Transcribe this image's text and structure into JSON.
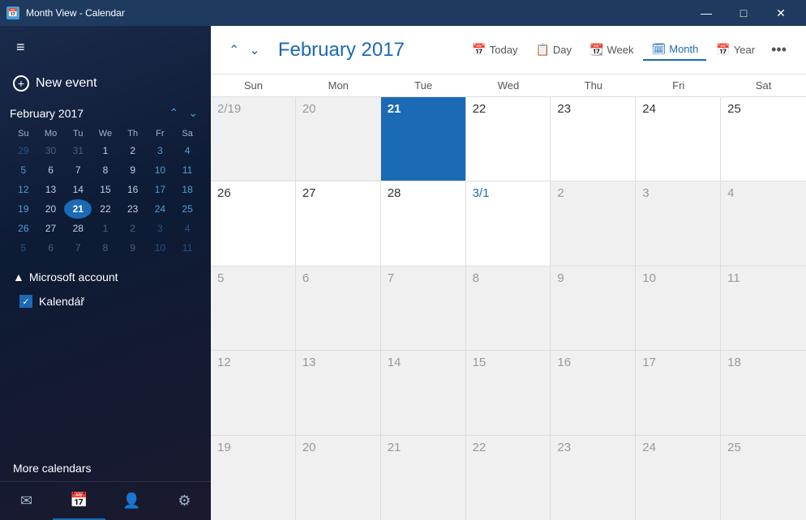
{
  "titlebar": {
    "title": "Month View - Calendar",
    "minimize": "—",
    "maximize": "□",
    "close": "✕"
  },
  "sidebar": {
    "hamburger": "≡",
    "new_event_label": "New event",
    "mini_calendar": {
      "title": "February 2017",
      "days_header": [
        "Su",
        "Mo",
        "Tu",
        "We",
        "Th",
        "Fr",
        "Sa"
      ],
      "weeks": [
        [
          {
            "d": "29",
            "cls": "other-month weekend"
          },
          {
            "d": "30",
            "cls": "other-month"
          },
          {
            "d": "31",
            "cls": "other-month"
          },
          {
            "d": "1",
            "cls": ""
          },
          {
            "d": "2",
            "cls": ""
          },
          {
            "d": "3",
            "cls": "weekend"
          },
          {
            "d": "4",
            "cls": "weekend"
          }
        ],
        [
          {
            "d": "5",
            "cls": "weekend"
          },
          {
            "d": "6",
            "cls": ""
          },
          {
            "d": "7",
            "cls": ""
          },
          {
            "d": "8",
            "cls": ""
          },
          {
            "d": "9",
            "cls": ""
          },
          {
            "d": "10",
            "cls": "weekend"
          },
          {
            "d": "11",
            "cls": "weekend"
          }
        ],
        [
          {
            "d": "12",
            "cls": "weekend"
          },
          {
            "d": "13",
            "cls": ""
          },
          {
            "d": "14",
            "cls": ""
          },
          {
            "d": "15",
            "cls": ""
          },
          {
            "d": "16",
            "cls": ""
          },
          {
            "d": "17",
            "cls": "weekend"
          },
          {
            "d": "18",
            "cls": "weekend"
          }
        ],
        [
          {
            "d": "19",
            "cls": "weekend"
          },
          {
            "d": "20",
            "cls": ""
          },
          {
            "d": "21",
            "cls": "today"
          },
          {
            "d": "22",
            "cls": ""
          },
          {
            "d": "23",
            "cls": ""
          },
          {
            "d": "24",
            "cls": "weekend"
          },
          {
            "d": "25",
            "cls": "weekend"
          }
        ],
        [
          {
            "d": "26",
            "cls": "weekend"
          },
          {
            "d": "27",
            "cls": ""
          },
          {
            "d": "28",
            "cls": ""
          },
          {
            "d": "1",
            "cls": "other-month"
          },
          {
            "d": "2",
            "cls": "other-month"
          },
          {
            "d": "3",
            "cls": "other-month weekend"
          },
          {
            "d": "4",
            "cls": "other-month weekend"
          }
        ],
        [
          {
            "d": "5",
            "cls": "other-month weekend"
          },
          {
            "d": "6",
            "cls": "other-month"
          },
          {
            "d": "7",
            "cls": "other-month"
          },
          {
            "d": "8",
            "cls": "other-month"
          },
          {
            "d": "9",
            "cls": "other-month"
          },
          {
            "d": "10",
            "cls": "other-month weekend"
          },
          {
            "d": "11",
            "cls": "other-month weekend"
          }
        ]
      ]
    },
    "accounts_header": "Microsoft account",
    "calendar_name": "Kalendář",
    "more_calendars": "More calendars"
  },
  "toolbar": {
    "title": "February 2017",
    "today_label": "Today",
    "day_label": "Day",
    "week_label": "Week",
    "month_label": "Month",
    "year_label": "Year"
  },
  "calendar": {
    "day_headers": [
      "Sun",
      "Mon",
      "Tue",
      "Wed",
      "Thu",
      "Fri",
      "Sat"
    ],
    "weeks": [
      [
        {
          "d": "2/19",
          "cls": "other-month"
        },
        {
          "d": "20",
          "cls": "other-month"
        },
        {
          "d": "21",
          "cls": "today"
        },
        {
          "d": "22",
          "cls": ""
        },
        {
          "d": "23",
          "cls": ""
        },
        {
          "d": "24",
          "cls": ""
        },
        {
          "d": "25",
          "cls": ""
        }
      ],
      [
        {
          "d": "26",
          "cls": ""
        },
        {
          "d": "27",
          "cls": ""
        },
        {
          "d": "28",
          "cls": ""
        },
        {
          "d": "3/1",
          "cls": "march-start"
        },
        {
          "d": "2",
          "cls": "other-month"
        },
        {
          "d": "3",
          "cls": "other-month"
        },
        {
          "d": "4",
          "cls": "other-month"
        }
      ],
      [
        {
          "d": "5",
          "cls": "other-month"
        },
        {
          "d": "6",
          "cls": "other-month"
        },
        {
          "d": "7",
          "cls": "other-month"
        },
        {
          "d": "8",
          "cls": "other-month"
        },
        {
          "d": "9",
          "cls": "other-month"
        },
        {
          "d": "10",
          "cls": "other-month"
        },
        {
          "d": "11",
          "cls": "other-month"
        }
      ],
      [
        {
          "d": "12",
          "cls": "other-month"
        },
        {
          "d": "13",
          "cls": "other-month"
        },
        {
          "d": "14",
          "cls": "other-month"
        },
        {
          "d": "15",
          "cls": "other-month"
        },
        {
          "d": "16",
          "cls": "other-month"
        },
        {
          "d": "17",
          "cls": "other-month"
        },
        {
          "d": "18",
          "cls": "other-month"
        }
      ],
      [
        {
          "d": "19",
          "cls": "other-month"
        },
        {
          "d": "20",
          "cls": "other-month"
        },
        {
          "d": "21",
          "cls": "other-month"
        },
        {
          "d": "22",
          "cls": "other-month"
        },
        {
          "d": "23",
          "cls": "other-month"
        },
        {
          "d": "24",
          "cls": "other-month"
        },
        {
          "d": "25",
          "cls": "other-month"
        }
      ]
    ]
  }
}
